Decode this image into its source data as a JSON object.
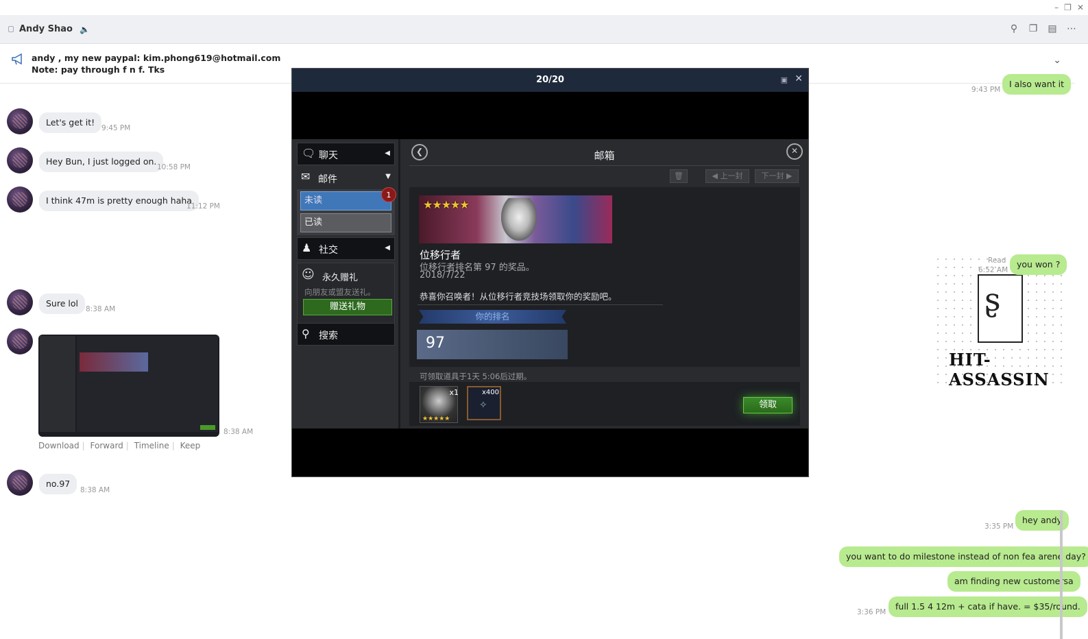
{
  "window": {
    "minimize": "–",
    "restore": "❐",
    "close": "✕"
  },
  "header": {
    "title": "Andy Shao"
  },
  "notice": {
    "line1": "andy , my new paypal: kim.phong619@hotmail.com",
    "line2": "Note: pay through f n f. Tks"
  },
  "messages_in": [
    {
      "text": "Let's get it!",
      "time": "9:45 PM"
    },
    {
      "text": "Hey Bun, I just logged on.",
      "time": "10:58 PM"
    },
    {
      "text": "I think 47m is pretty enough haha",
      "time": "11:12 PM"
    },
    {
      "text": "Sure lol",
      "time": "8:38 AM"
    },
    {
      "text": "no.97",
      "time": "8:38 AM"
    }
  ],
  "image_message": {
    "time": "8:38 AM",
    "actions": [
      "Download",
      "Forward",
      "Timeline",
      "Keep"
    ]
  },
  "messages_out": [
    {
      "text": "I also want it",
      "time": "9:43 PM"
    },
    {
      "text": "you won ?",
      "time": "6:52 AM",
      "status": "Read"
    },
    {
      "text": "hey andy",
      "time": "3:35 PM"
    },
    {
      "text": "you want to do milestone instead of non fea arene day?"
    },
    {
      "text": "am finding new customersa"
    },
    {
      "text": "full 1.5 4 12m + cata if have. = $35/round.",
      "time": "3:36 PM"
    }
  ],
  "watermark": {
    "glyph": "ʂ",
    "name": "HIT-ASSASSIN"
  },
  "viewer": {
    "counter": "20/20",
    "game": {
      "sidebar": {
        "chat": "聊天",
        "mail": "邮件",
        "unread": "未读",
        "read": "已读",
        "badge": "1",
        "social": "社交",
        "gift_title": "永久赠礼",
        "gift_desc": "向朋友或盟友送礼。",
        "gift_button": "赠送礼物",
        "search": "搜索"
      },
      "main": {
        "title": "邮箱",
        "prev": "上一封",
        "next": "下一封",
        "stars": "★★★★★",
        "mail_name": "位移行者",
        "mail_sub": "位移行者排名第 97 的奖品。",
        "mail_date": "2018/7/22",
        "mail_body": "恭喜你召唤者！从位移行者竞技场领取你的奖励吧。",
        "rank_label": "你的排名",
        "rank_value": "97",
        "expire": "可领取道具于1天 5:06后过期。",
        "item1_count": "x1",
        "item1_stars": "★★★★★",
        "item2_count": "x400",
        "claim": "领取"
      }
    }
  }
}
